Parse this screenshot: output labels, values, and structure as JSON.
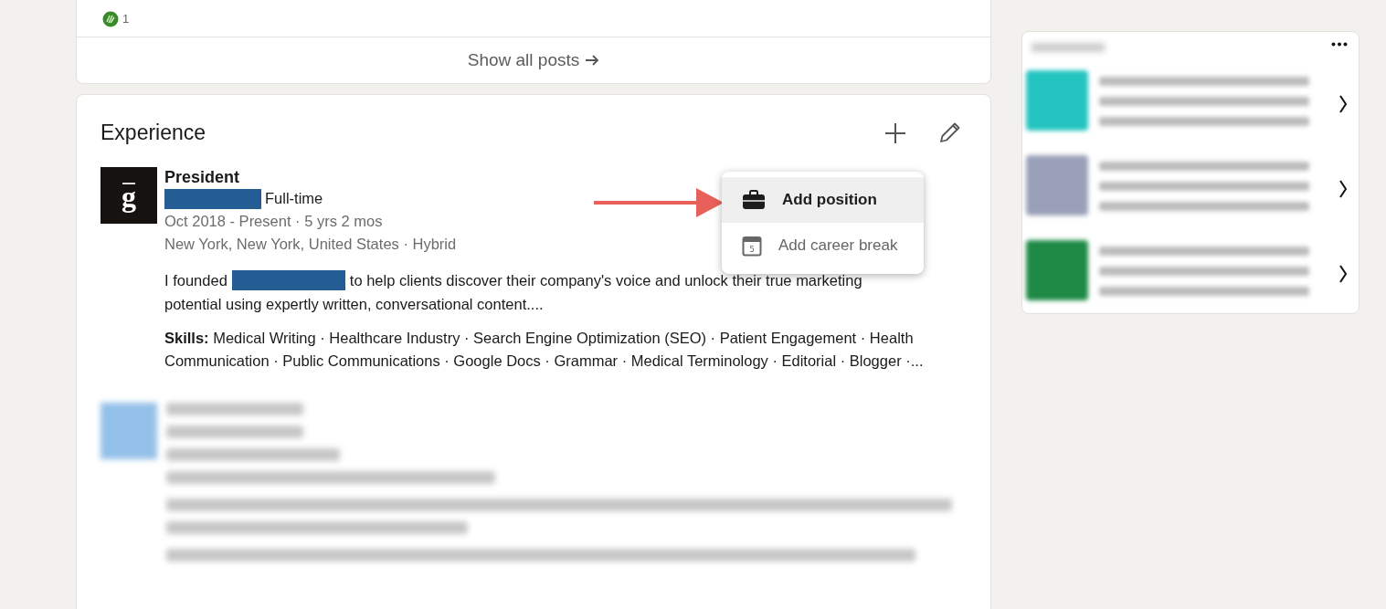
{
  "posts_card": {
    "reaction_count": "1",
    "show_all": "Show all posts"
  },
  "experience": {
    "title": "Experience",
    "menu": [
      {
        "kind": "position",
        "label": "Add position",
        "selected": true
      },
      {
        "kind": "career-break",
        "label": "Add career break",
        "icon_text": "5",
        "selected": false
      }
    ],
    "entry": {
      "logo_text": "g",
      "title": "President",
      "employment_type": "Full-time",
      "dates": "Oct 2018 - Present · 5 yrs 2 mos",
      "location": "New York, New York, United States · Hybrid",
      "description_start": "I founded",
      "description_line_end": "to help clients discover their company's voice and unlock their true marketing",
      "description_line_2": "potential using expertly written, conversational content....",
      "skills": "**Skills:** Medical Writing · Healthcare Industry · Search Engine Optimization (SEO) · Patient Engagement · Health Communication · Public Communications · Google Docs · Grammar · Medical Terminology · Editorial · Blogger ·..."
    }
  }
}
